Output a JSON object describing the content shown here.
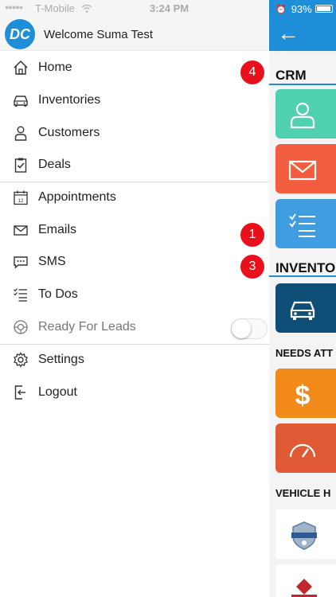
{
  "status_bar": {
    "signal": "●●●●●",
    "carrier": "T-Mobile",
    "time": "3:24 PM",
    "battery": "93%"
  },
  "header": {
    "avatar_text": "DC",
    "welcome": "Welcome Suma Test"
  },
  "menu": {
    "home": "Home",
    "home_badge": "4",
    "inventories": "Inventories",
    "customers": "Customers",
    "deals": "Deals",
    "appointments": "Appointments",
    "emails": "Emails",
    "emails_badge": "1",
    "sms": "SMS",
    "sms_badge": "3",
    "todos": "To Dos",
    "ready_for_leads": "Ready For Leads",
    "ready_for_leads_on": false,
    "settings": "Settings",
    "logout": "Logout"
  },
  "background": {
    "section_crm": "CRM",
    "section_inventory": "INVENTO",
    "section_needs": "NEEDS ATT",
    "section_vehicle": "VEHICLE H"
  },
  "colors": {
    "brand_blue": "#1e8ed8",
    "badge_red": "#e8101b",
    "tile_green": "#4fd1b0",
    "tile_red": "#f25c3f",
    "tile_blue": "#3f9de0",
    "tile_navy": "#0f4f77",
    "tile_orange": "#f28a1a",
    "tile_rust": "#e05a35"
  }
}
